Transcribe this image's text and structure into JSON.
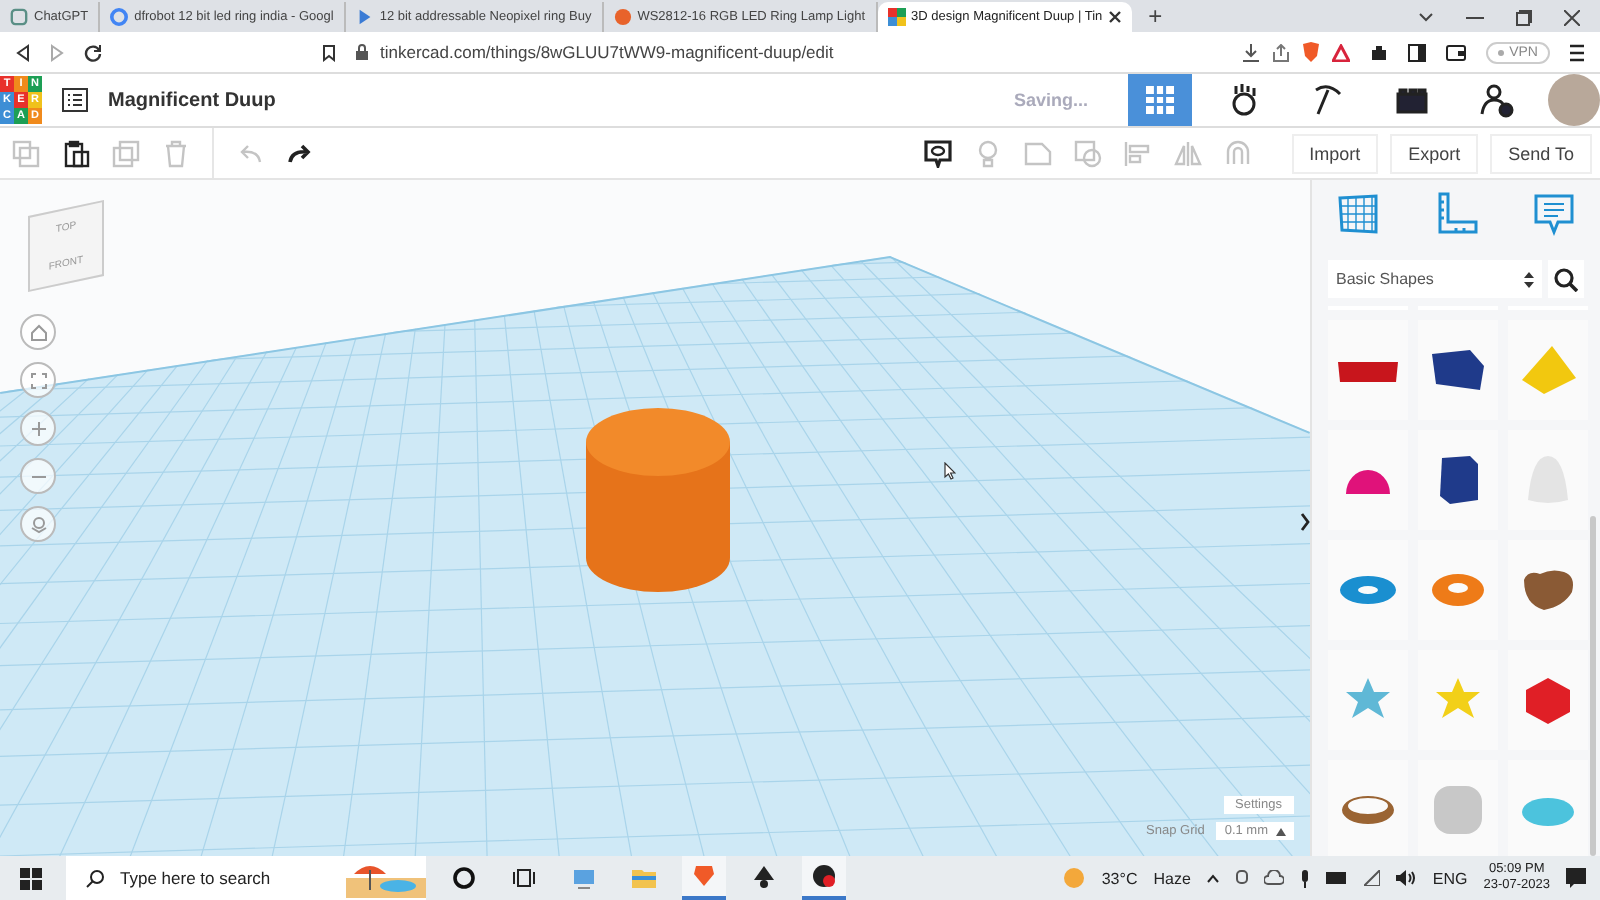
{
  "browser": {
    "tabs": [
      {
        "title": "ChatGPT",
        "kind": "chat",
        "selected": false
      },
      {
        "title": "dfrobot 12 bit led ring india - Googl",
        "kind": "google",
        "selected": false
      },
      {
        "title": "12 bit addressable Neopixel ring Buy",
        "kind": "play",
        "selected": false
      },
      {
        "title": "WS2812-16 RGB LED Ring Lamp Light",
        "kind": "lion",
        "selected": false
      },
      {
        "title": "3D design Magnificent Duup | Tin",
        "kind": "tinkercad",
        "selected": true
      }
    ],
    "new_tab": "+",
    "url": "tinkercad.com/things/8wGLUU7tWW9-magnificent-duup/edit",
    "vpn": "VPN"
  },
  "header": {
    "logo_letters": [
      "T",
      "I",
      "N",
      "K",
      "E",
      "R",
      "C",
      "A",
      "D"
    ],
    "title": "Magnificent Duup",
    "status": "Saving...",
    "view_buttons": [
      {
        "kind": "grid",
        "selected": true
      },
      {
        "kind": "hand",
        "selected": false
      },
      {
        "kind": "pickaxe",
        "selected": false
      },
      {
        "kind": "bricks",
        "selected": false
      },
      {
        "kind": "user-add",
        "selected": false
      }
    ]
  },
  "toolbar": {
    "edit_tools": [
      {
        "kind": "copy",
        "disabled": true
      },
      {
        "kind": "paste",
        "disabled": false
      },
      {
        "kind": "duplicate",
        "disabled": true
      },
      {
        "kind": "delete",
        "disabled": true
      },
      {
        "kind": "undo",
        "disabled": true
      },
      {
        "kind": "redo",
        "disabled": false
      }
    ],
    "shape_tools": [
      {
        "kind": "note",
        "disabled": false
      },
      {
        "kind": "bulb",
        "disabled": true
      },
      {
        "kind": "shape",
        "disabled": true
      },
      {
        "kind": "group",
        "disabled": true
      },
      {
        "kind": "align",
        "disabled": true
      },
      {
        "kind": "mirror",
        "disabled": true
      },
      {
        "kind": "magnet",
        "disabled": true
      }
    ],
    "actions": [
      "Import",
      "Export",
      "Send To"
    ]
  },
  "workplane": {
    "view_cube": {
      "top": "TOP",
      "front": "FRONT"
    },
    "nav_buttons": [
      {
        "kind": "home"
      },
      {
        "kind": "fit"
      },
      {
        "kind": "zoom-in"
      },
      {
        "kind": "zoom-out"
      },
      {
        "kind": "orbit"
      }
    ],
    "settings": "Settings",
    "snap_grid_label": "Snap Grid",
    "snap_grid_value": "0.1 mm"
  },
  "panel": {
    "tools": [
      {
        "kind": "grid"
      },
      {
        "kind": "ruler"
      },
      {
        "kind": "note"
      }
    ],
    "category": "Basic Shapes",
    "shapes": [
      {
        "kind": "text",
        "color": "#c8151c"
      },
      {
        "kind": "box",
        "color": "#1f3a8a"
      },
      {
        "kind": "pyramid",
        "color": "#f2c80f"
      },
      {
        "kind": "half-sphere",
        "color": "#e0127a"
      },
      {
        "kind": "hexagon",
        "color": "#1f3a8a"
      },
      {
        "kind": "paraboloid",
        "color": "#e4e4e4"
      },
      {
        "kind": "torus",
        "color": "#1a8fd0"
      },
      {
        "kind": "tube",
        "color": "#ee7b18"
      },
      {
        "kind": "heart",
        "color": "#8a5a35"
      },
      {
        "kind": "star",
        "color": "#5fb8d6"
      },
      {
        "kind": "star",
        "color": "#f2d018"
      },
      {
        "kind": "icosahedron",
        "color": "#e01f26"
      },
      {
        "kind": "ring",
        "color": "#9a6433"
      },
      {
        "kind": "rounded-cube",
        "color": "#c8c8c8"
      },
      {
        "kind": "dish",
        "color": "#4cc3dd"
      }
    ]
  },
  "taskbar": {
    "search_placeholder": "Type here to search",
    "apps": [
      {
        "kind": "cortana",
        "running": false
      },
      {
        "kind": "task-view",
        "running": false
      },
      {
        "kind": "monitor",
        "running": false
      },
      {
        "kind": "folder",
        "running": false
      },
      {
        "kind": "brave",
        "running": true
      },
      {
        "kind": "inkscape",
        "running": false
      },
      {
        "kind": "recorder",
        "running": true
      }
    ],
    "temperature": "33°C",
    "weather": "Haze",
    "language": "ENG",
    "time": "05:09 PM",
    "date": "23-07-2023"
  }
}
